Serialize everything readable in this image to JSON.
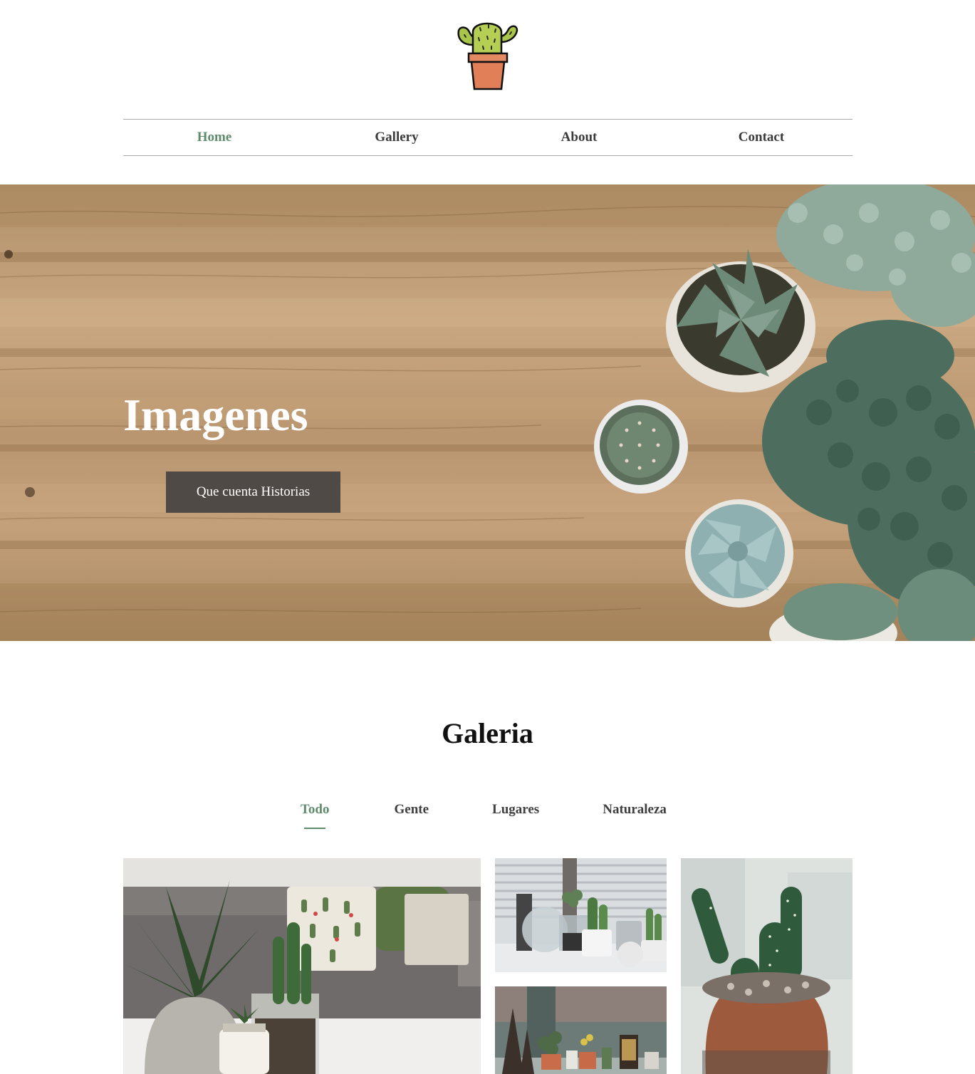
{
  "nav": {
    "items": [
      {
        "label": "Home",
        "active": true
      },
      {
        "label": "Gallery",
        "active": false
      },
      {
        "label": "About",
        "active": false
      },
      {
        "label": "Contact",
        "active": false
      }
    ]
  },
  "hero": {
    "title": "Imagenes",
    "button_label": "Que cuenta Historias"
  },
  "gallery": {
    "title": "Galeria",
    "filters": [
      {
        "label": "Todo",
        "active": true
      },
      {
        "label": "Gente",
        "active": false
      },
      {
        "label": "Lugares",
        "active": false
      },
      {
        "label": "Naturaleza",
        "active": false
      }
    ]
  },
  "colors": {
    "accent": "#5f8b6d",
    "nav_text": "#3b3b3b",
    "hero_button_bg": "#4f4a46"
  },
  "icons": {
    "logo": "cactus-pot-icon"
  }
}
